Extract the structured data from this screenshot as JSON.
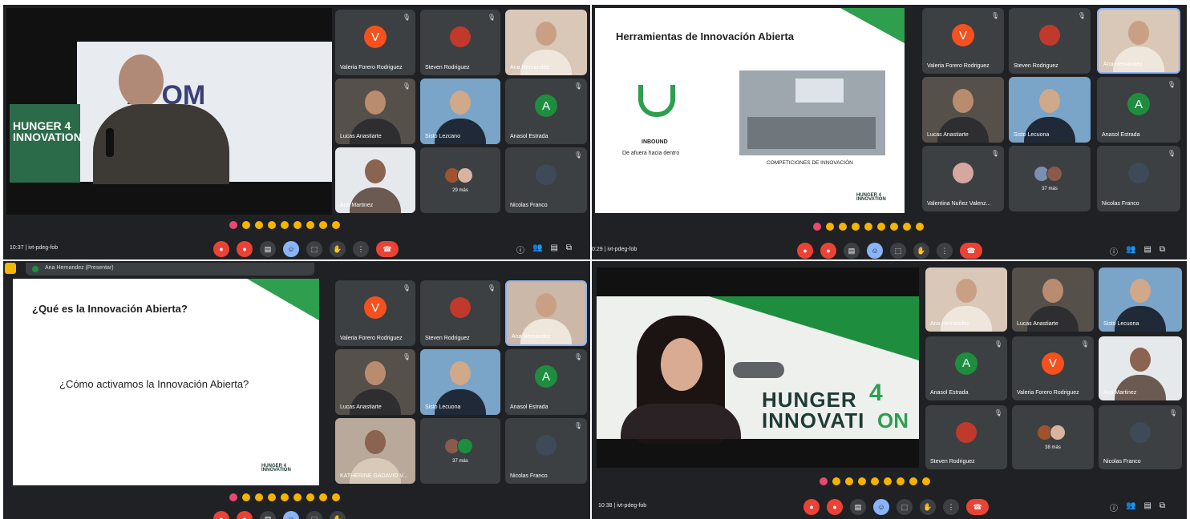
{
  "q1": {
    "meeting": "10:37  |  ivt-pdeg-fob",
    "brand_fragment": "AI  OM",
    "logo": "HUNGER 4 INNOVATION",
    "people": [
      {
        "name": "Valeria Forero Rodriguez",
        "initial": "V"
      },
      {
        "name": "Steven Rodriguez"
      },
      {
        "name": "Ana Hernandez"
      },
      {
        "name": "Lucas Anastiarte"
      },
      {
        "name": "Sisto Lezcano"
      },
      {
        "name": "Anasol Estrada",
        "initial": "A"
      },
      {
        "name": "Ana Martinez"
      },
      {
        "name": "",
        "more": "29 más"
      },
      {
        "name": "Nicolas Franco"
      }
    ]
  },
  "q2": {
    "meeting": "0:29  |  ivt-pdeg-fob",
    "slide_title": "Herramientas de Innovación Abierta",
    "inbound": "INBOUND",
    "inbound_sub": "De afuera hacia dentro",
    "competitions": "COMPETICIONES DE INNOVACIÓN",
    "logo": "HUNGER 4 INNOVATION",
    "people": [
      {
        "name": "Valeria Forero Rodriguez",
        "initial": "V"
      },
      {
        "name": "Steven Rodriguez"
      },
      {
        "name": "Ana Hernandez"
      },
      {
        "name": "Lucas Anastiarte"
      },
      {
        "name": "Sisto Lecuona"
      },
      {
        "name": "Anasol Estrada",
        "initial": "A"
      },
      {
        "name": "Valentina Nuñez Valenz..."
      },
      {
        "name": "",
        "more": "37 más"
      },
      {
        "name": "Nicolas Franco"
      }
    ]
  },
  "q3": {
    "presenter": "Ana Hernandez (Presentar)",
    "slide_title": "¿Qué es la Innovación Abierta?",
    "slide_question": "¿Cómo activamos la Innovación Abierta?",
    "logo": "HUNGER 4 INNOVATION",
    "people": [
      {
        "name": "Valeria Forero Rodriguez",
        "initial": "V"
      },
      {
        "name": "Steven Rodriguez"
      },
      {
        "name": "Ana Hernandez"
      },
      {
        "name": "Lucas Anastiarte"
      },
      {
        "name": "Sisto Lecuona"
      },
      {
        "name": "Anasol Estrada",
        "initial": "A"
      },
      {
        "name": "KATHERINE GADAVID V..."
      },
      {
        "name": "",
        "more": "37 más"
      },
      {
        "name": "Nicolas Franco"
      }
    ]
  },
  "q4": {
    "meeting": "10:38  |  ivt-pdeg-fob",
    "banner_line1": "HUNGER",
    "banner_line2": "INNOVATI",
    "banner_on": "ON",
    "banner_four": "4",
    "people": [
      {
        "name": "Ana Hernandez"
      },
      {
        "name": "Lucas Anastiarte"
      },
      {
        "name": "Sisto Lecuona"
      },
      {
        "name": "Anasol Estrada",
        "initial": "A"
      },
      {
        "name": "Valeria Forero Rodriguez",
        "initial": "V"
      },
      {
        "name": "Ana Martinez"
      },
      {
        "name": "Steven Rodriguez"
      },
      {
        "name": "",
        "more": "38 más"
      },
      {
        "name": "Nicolas Franco"
      }
    ]
  },
  "controls": {
    "mic": "●",
    "cam": "●",
    "cc": "▤",
    "emoji": "☺",
    "present": "⬚",
    "hand": "✋",
    "more": "⋮",
    "leave": "☎",
    "info": "ⓘ",
    "people": "👥",
    "chat": "▤",
    "activities": "⧉"
  },
  "colors": {
    "red": "#ea4335",
    "orange": "#f4511e",
    "green": "#1e8e3e",
    "accent": "#2e9e4f"
  }
}
